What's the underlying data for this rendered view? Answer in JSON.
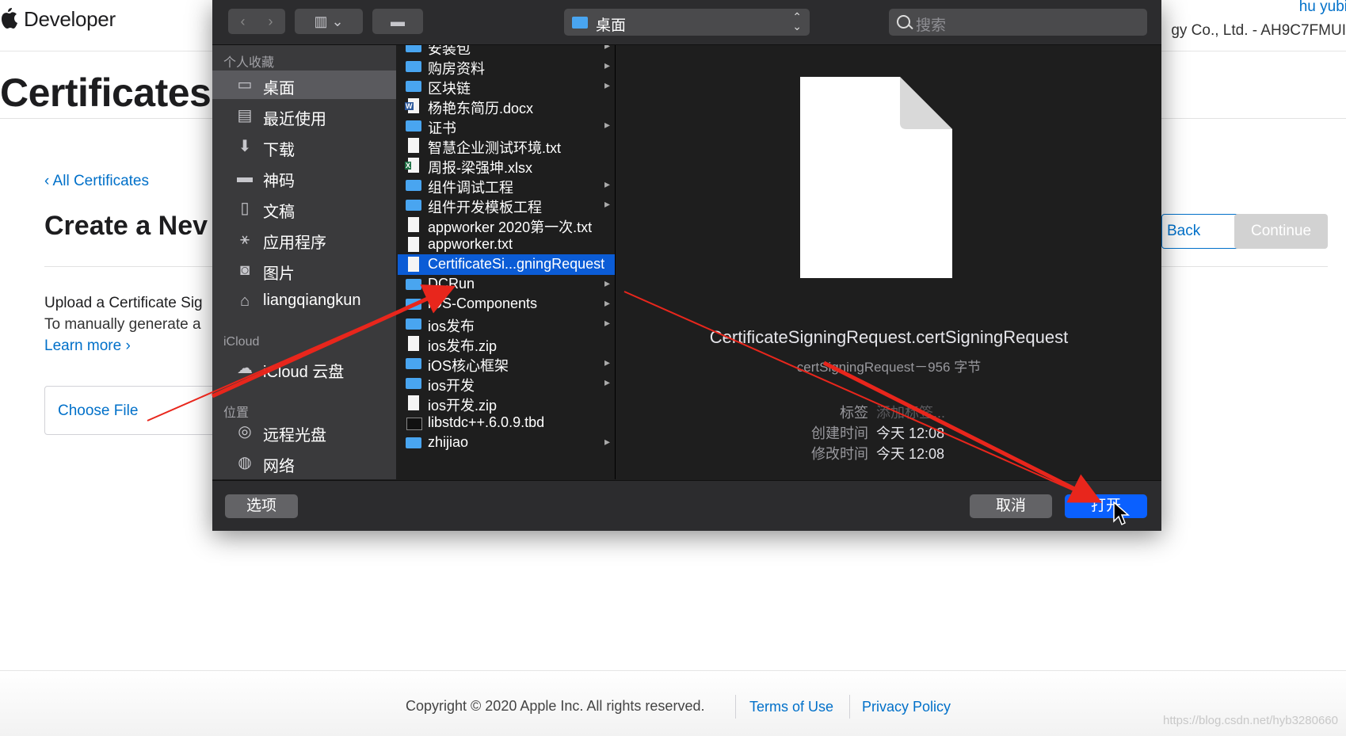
{
  "header": {
    "brand": "Developer",
    "user_name": "hu yubi",
    "team": "gy Co., Ltd. - AH9C7FMUI"
  },
  "page": {
    "title": "Certificates",
    "back_link": "‹ All Certificates",
    "create_title": "Create a Nev",
    "back_button": "Back",
    "continue_button": "Continue",
    "upload_title": "Upload a Certificate Sig",
    "upload_desc": "To manually generate a",
    "learn_more": "Learn more ›",
    "choose_file": "Choose File"
  },
  "footer": {
    "copyright": "Copyright © 2020 Apple Inc. All rights reserved.",
    "terms": "Terms of Use",
    "privacy": "Privacy Policy",
    "watermark": "https://blog.csdn.net/hyb3280660"
  },
  "dialog": {
    "toolbar": {
      "back": "‹",
      "forward": "›",
      "view": "▥ ⌄",
      "new_folder": "▬",
      "path_label": "桌面",
      "search_placeholder": "搜索"
    },
    "sidebar": {
      "favorites_header": "个人收藏",
      "favorites": [
        {
          "label": "桌面",
          "icon": "desktop-icon",
          "glyph": "▭"
        },
        {
          "label": "最近使用",
          "icon": "recents-icon",
          "glyph": "▤"
        },
        {
          "label": "下载",
          "icon": "download-icon",
          "glyph": "⬇"
        },
        {
          "label": "神码",
          "icon": "folder-icon",
          "glyph": "▬"
        },
        {
          "label": "文稿",
          "icon": "documents-icon",
          "glyph": "▯"
        },
        {
          "label": "应用程序",
          "icon": "applications-icon",
          "glyph": "⚹"
        },
        {
          "label": "图片",
          "icon": "pictures-icon",
          "glyph": "◙"
        },
        {
          "label": "liangqiangkun",
          "icon": "home-icon",
          "glyph": "⌂"
        }
      ],
      "icloud_header": "iCloud",
      "icloud": [
        {
          "label": "iCloud 云盘",
          "icon": "cloud-icon",
          "glyph": "☁"
        }
      ],
      "locations_header": "位置",
      "locations": [
        {
          "label": "远程光盘",
          "icon": "disc-icon",
          "glyph": "◎"
        },
        {
          "label": "网络",
          "icon": "network-icon",
          "glyph": "◍"
        }
      ]
    },
    "files": [
      {
        "name": "安装包",
        "type": "folder",
        "chev": "▸"
      },
      {
        "name": "购房资料",
        "type": "folder",
        "chev": "▸"
      },
      {
        "name": "区块链",
        "type": "folder",
        "chev": "▸"
      },
      {
        "name": "杨艳东简历.docx",
        "type": "word",
        "chev": ""
      },
      {
        "name": "证书",
        "type": "folder",
        "chev": "▸"
      },
      {
        "name": "智慧企业测试环境.txt",
        "type": "doc",
        "chev": ""
      },
      {
        "name": "周报-梁强坤.xlsx",
        "type": "excel",
        "chev": ""
      },
      {
        "name": "组件调试工程",
        "type": "folder",
        "chev": "▸"
      },
      {
        "name": "组件开发模板工程",
        "type": "folder",
        "chev": "▸"
      },
      {
        "name": "appworker 2020第一次.txt",
        "type": "doc",
        "chev": ""
      },
      {
        "name": "appworker.txt",
        "type": "doc",
        "chev": ""
      },
      {
        "name": "CertificateSi...gningRequest",
        "type": "doc",
        "chev": ""
      },
      {
        "name": "DCRun",
        "type": "folder",
        "chev": "▸"
      },
      {
        "name": "iOS-Components",
        "type": "folder",
        "chev": "▸"
      },
      {
        "name": "ios发布",
        "type": "folder",
        "chev": "▸"
      },
      {
        "name": "ios发布.zip",
        "type": "doc",
        "chev": ""
      },
      {
        "name": "iOS核心框架",
        "type": "folder",
        "chev": "▸"
      },
      {
        "name": "ios开发",
        "type": "folder",
        "chev": "▸"
      },
      {
        "name": "ios开发.zip",
        "type": "doc",
        "chev": ""
      },
      {
        "name": "libstdc++.6.0.9.tbd",
        "type": "exec",
        "chev": ""
      },
      {
        "name": "zhijiao",
        "type": "folder",
        "chev": "▸"
      }
    ],
    "preview": {
      "file_name": "CertificateSigningRequest.certSigningRequest",
      "kind": "certSigningRequest－956 字节",
      "tags_label": "标签",
      "tags_value": "添加标签...",
      "created_label": "创建时间",
      "created_value": "今天 12:08",
      "modified_label": "修改时间",
      "modified_value": "今天 12:08"
    },
    "buttons": {
      "options": "选项",
      "cancel": "取消",
      "open": "打开"
    }
  },
  "colors": {
    "link_blue": "#0070c9",
    "selection_blue": "#0b5cd6",
    "primary_button": "#0a60ff",
    "annotation_red": "#e8261c"
  }
}
